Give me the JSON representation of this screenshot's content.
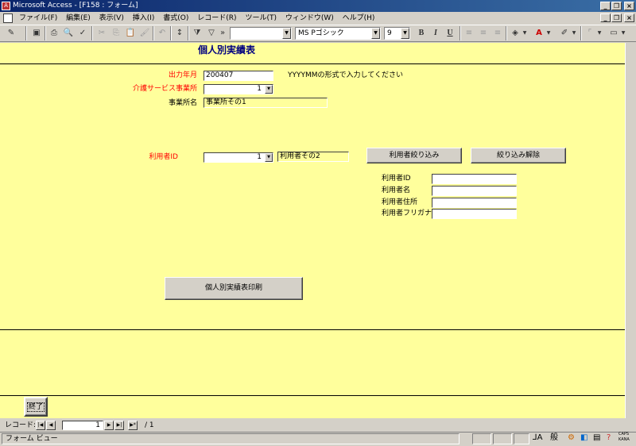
{
  "window": {
    "title": "Microsoft Access - [F158 : フォーム]"
  },
  "menu": {
    "items": [
      "ファイル(F)",
      "編集(E)",
      "表示(V)",
      "挿入(I)",
      "書式(O)",
      "レコード(R)",
      "ツール(T)",
      "ウィンドウ(W)",
      "ヘルプ(H)"
    ]
  },
  "toolbar": {
    "font_name": "MS Pゴシック",
    "font_size": "9",
    "bold": "B",
    "italic": "I",
    "underline": "U"
  },
  "form": {
    "title": "個人別実績表",
    "output_month": {
      "label": "出力年月",
      "value": "200407",
      "hint": "YYYYMMの形式で入力してください"
    },
    "service_office": {
      "label": "介護サービス事業所",
      "value": "1"
    },
    "office_name": {
      "label": "事業所名",
      "value": "事業所その1"
    },
    "user_id": {
      "label": "利用者ID",
      "value": "1",
      "name_value": "利用者その2"
    },
    "filter_button": "利用者絞り込み",
    "clear_filter_button": "絞り込み解除",
    "detail": {
      "id_label": "利用者ID",
      "name_label": "利用者名",
      "address_label": "利用者住所",
      "kana_label": "利用者フリガナ",
      "id_value": "",
      "name_value": "",
      "address_value": "",
      "kana_value": ""
    },
    "print_button": "個人別実績表印刷",
    "exit_button": "終了"
  },
  "navigation": {
    "label": "レコード:",
    "current": "1",
    "total": "/ 1"
  },
  "status": {
    "text": "フォーム ビュー",
    "caps": "CAPS",
    "kana": "KANA",
    "ime": "般"
  },
  "colors": {
    "form_background": "#ffff9c",
    "title_bar": "#0a246a",
    "required_label": "#ff0000",
    "title_text": "#000080"
  }
}
